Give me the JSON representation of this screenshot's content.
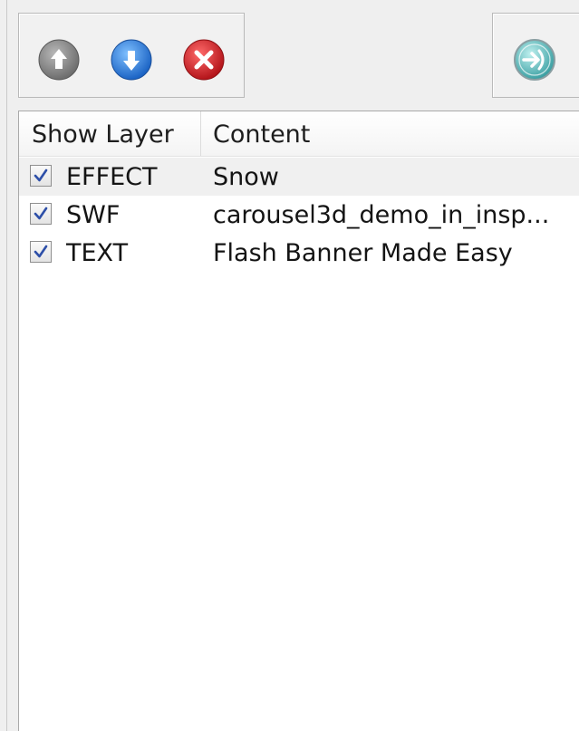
{
  "toolbar": {
    "buttons": [
      {
        "icon": "arrow-up-icon",
        "color": "#8a8a8a"
      },
      {
        "icon": "arrow-down-icon",
        "color": "#2f7fd8"
      },
      {
        "icon": "delete-icon",
        "color": "#d42428"
      }
    ],
    "apply_button": {
      "icon": "apply-arrow-icon",
      "color": "#3aa5a6"
    }
  },
  "layers_table": {
    "columns": [
      "Show Layer",
      "Content"
    ],
    "rows": [
      {
        "visible": true,
        "layer": "EFFECT",
        "content": "Snow"
      },
      {
        "visible": true,
        "layer": "SWF",
        "content": "carousel3d_demo_in_insp..."
      },
      {
        "visible": true,
        "layer": "TEXT",
        "content": "Flash Banner Made Easy"
      }
    ]
  },
  "colors": {
    "checkbox_check": "#2d4fa8",
    "alt_row": "#f0f0f0"
  }
}
